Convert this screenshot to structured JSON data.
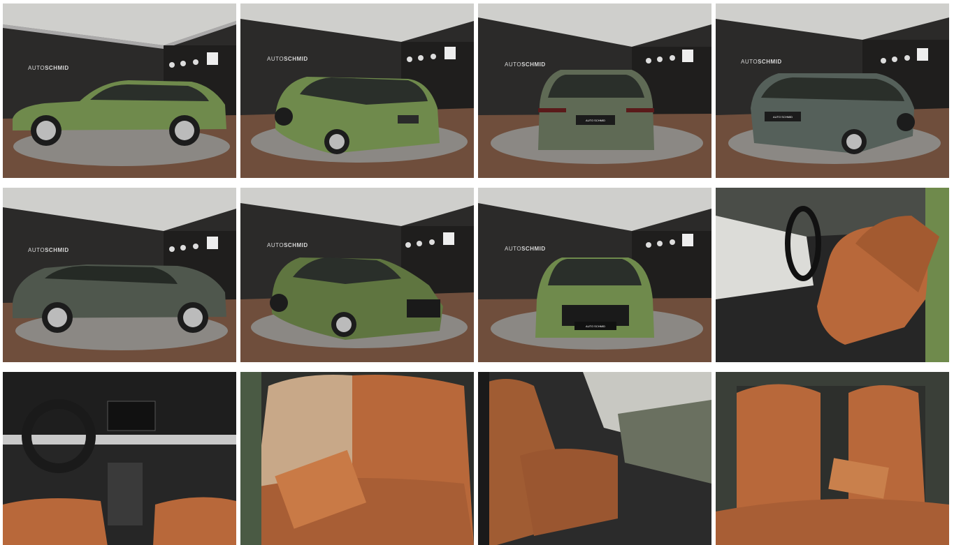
{
  "gallery": {
    "dealer_logo": {
      "prefix": "AUTO",
      "name": "SCHMID",
      "plate": "AUTO SCHMID"
    },
    "photos": [
      {
        "view": "side-left",
        "color": "#6f8a4c"
      },
      {
        "view": "rear-three-quarter-left",
        "color": "#6f8a4c"
      },
      {
        "view": "rear",
        "color": "#5f6a55"
      },
      {
        "view": "rear-three-quarter-right",
        "color": "#55605a"
      },
      {
        "view": "side-left-shade",
        "color": "#4f574d"
      },
      {
        "view": "front-three-quarter-left",
        "color": "#5f7540"
      },
      {
        "view": "front",
        "color": "#6f8a4c"
      },
      {
        "view": "interior-front-seat",
        "color": "#b8683a"
      },
      {
        "view": "interior-dashboard",
        "color": "#b8683a"
      },
      {
        "view": "interior-rear-bench",
        "color": "#b8683a"
      },
      {
        "view": "interior-front-side",
        "color": "#a05c33"
      },
      {
        "view": "interior-rear-bench-armrest",
        "color": "#b8683a"
      }
    ],
    "colors": {
      "showroom_wall": "#2b2a29",
      "showroom_ceiling": "#cfcfcc",
      "floor_wood": "#6f4e3c",
      "turntable": "#8b8884",
      "leather": "#b8683a",
      "cabin_dark": "#262626"
    }
  }
}
